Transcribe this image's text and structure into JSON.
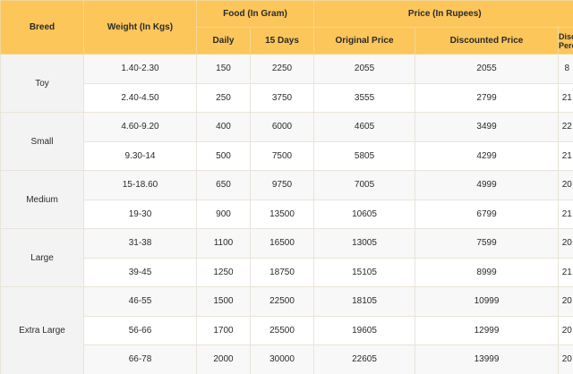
{
  "headers": {
    "breed": "Breed",
    "weight": "Weight (In Kgs)",
    "food": "Food (In Gram)",
    "price": "Price (In Rupees)",
    "daily": "Daily",
    "fifteen_days": "15 Days",
    "original_price": "Original Price",
    "discounted_price": "Discounted Price",
    "discount_percent": "Discount Percent"
  },
  "groups": [
    {
      "breed": "Toy",
      "rows": [
        {
          "weight": "1.40-2.30",
          "daily": "150",
          "fifteen": "2250",
          "original": "2055",
          "discounted": "2055",
          "discount": "8"
        },
        {
          "weight": "2.40-4.50",
          "daily": "250",
          "fifteen": "3750",
          "original": "3555",
          "discounted": "2799",
          "discount": "21"
        }
      ]
    },
    {
      "breed": "Small",
      "rows": [
        {
          "weight": "4.60-9.20",
          "daily": "400",
          "fifteen": "6000",
          "original": "4605",
          "discounted": "3499",
          "discount": "22"
        },
        {
          "weight": "9.30-14",
          "daily": "500",
          "fifteen": "7500",
          "original": "5805",
          "discounted": "4299",
          "discount": "21"
        }
      ]
    },
    {
      "breed": "Medium",
      "rows": [
        {
          "weight": "15-18.60",
          "daily": "650",
          "fifteen": "9750",
          "original": "7005",
          "discounted": "4999",
          "discount": "20"
        },
        {
          "weight": "19-30",
          "daily": "900",
          "fifteen": "13500",
          "original": "10605",
          "discounted": "6799",
          "discount": "21"
        }
      ]
    },
    {
      "breed": "Large",
      "rows": [
        {
          "weight": "31-38",
          "daily": "1100",
          "fifteen": "16500",
          "original": "13005",
          "discounted": "7599",
          "discount": "20"
        },
        {
          "weight": "39-45",
          "daily": "1250",
          "fifteen": "18750",
          "original": "15105",
          "discounted": "8999",
          "discount": "21"
        }
      ]
    },
    {
      "breed": "Extra Large",
      "rows": [
        {
          "weight": "46-55",
          "daily": "1500",
          "fifteen": "22500",
          "original": "18105",
          "discounted": "10999",
          "discount": "20"
        },
        {
          "weight": "56-66",
          "daily": "1700",
          "fifteen": "25500",
          "original": "19605",
          "discounted": "12999",
          "discount": "20"
        },
        {
          "weight": "66-78",
          "daily": "2000",
          "fifteen": "30000",
          "original": "22605",
          "discounted": "13999",
          "discount": "20"
        }
      ]
    }
  ],
  "colors": {
    "header_bg": "#fcc65a",
    "row_alt_bg": "#f8f8f8",
    "breed_cell_bg": "#f3f3f3"
  }
}
